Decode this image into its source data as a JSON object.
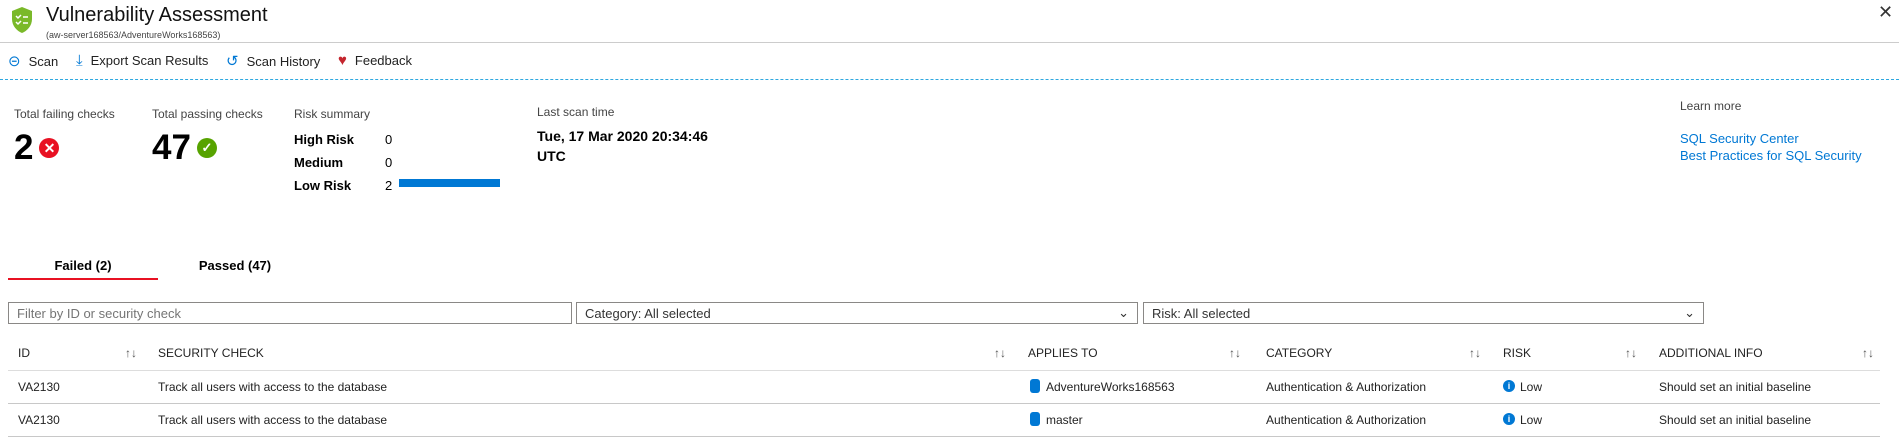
{
  "header": {
    "title": "Vulnerability Assessment",
    "subtitle": "(aw-server168563/AdventureWorks168563)"
  },
  "toolbar": {
    "scan": "Scan",
    "export": "Export Scan Results",
    "history": "Scan History",
    "feedback": "Feedback"
  },
  "stats": {
    "failing_label": "Total failing checks",
    "failing_value": "2",
    "passing_label": "Total passing checks",
    "passing_value": "47",
    "risk_label": "Risk summary",
    "risks": [
      {
        "label": "High Risk",
        "count": "0"
      },
      {
        "label": "Medium",
        "count": "0"
      },
      {
        "label": "Low Risk",
        "count": "2"
      }
    ],
    "scan_label": "Last scan time",
    "scan_time": "Tue, 17 Mar 2020 20:34:46",
    "scan_tz": "UTC"
  },
  "learn": {
    "label": "Learn more",
    "links": [
      "SQL Security Center",
      "Best Practices for SQL Security"
    ]
  },
  "tabs": [
    "Failed (2)",
    "Passed (47)"
  ],
  "filters": {
    "search_placeholder": "Filter by ID or security check",
    "category": "Category: All selected",
    "risk": "Risk: All selected"
  },
  "table": {
    "columns": [
      "ID",
      "SECURITY CHECK",
      "APPLIES TO",
      "CATEGORY",
      "RISK",
      "ADDITIONAL INFO"
    ],
    "rows": [
      {
        "id": "VA2130",
        "check": "Track all users with access to the database",
        "applies": "AdventureWorks168563",
        "category": "Authentication & Authorization",
        "risk": "Low",
        "info": "Should set an initial baseline"
      },
      {
        "id": "VA2130",
        "check": "Track all users with access to the database",
        "applies": "master",
        "category": "Authentication & Authorization",
        "risk": "Low",
        "info": "Should set an initial baseline"
      }
    ]
  },
  "colors": {
    "accent": "#0078d4",
    "fail": "#e81123",
    "pass": "#57a300",
    "tab_underline": "#e81123"
  }
}
